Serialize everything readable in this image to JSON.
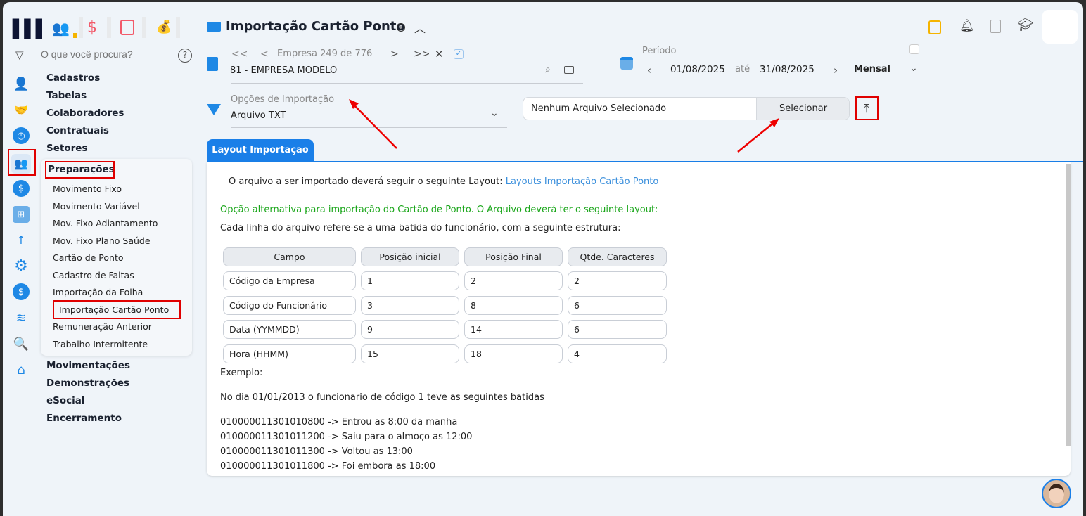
{
  "top_modules": [
    "people-icon",
    "dollar-icon",
    "calculator-icon",
    "money-bag-icon"
  ],
  "search": {
    "placeholder": "O que você procura?"
  },
  "sidebar": {
    "main_top": [
      "Cadastros",
      "Tabelas",
      "Colaboradores",
      "Contratuais",
      "Setores"
    ],
    "active_group": "Preparações",
    "sub_items": [
      "Movimento Fixo",
      "Movimento Variável",
      "Mov. Fixo Adiantamento",
      "Mov. Fixo Plano Saúde",
      "Cartão de Ponto",
      "Cadastro de Faltas",
      "Importação da Folha",
      "Importação Cartão Ponto",
      "Remuneração Anterior",
      "Trabalho Intermitente"
    ],
    "main_bottom": [
      "Movimentações",
      "Demonstrações",
      "eSocial",
      "Encerramento"
    ]
  },
  "header": {
    "title": "Importação Cartão Ponto"
  },
  "empresa": {
    "nav_label": "Empresa",
    "current": "249",
    "sep": "de",
    "total": "776",
    "value": "81 - EMPRESA MODELO"
  },
  "periodo": {
    "label": "Período",
    "from": "01/08/2025",
    "sep": "até",
    "to": "31/08/2025",
    "mode": "Mensal"
  },
  "opcoes": {
    "label": "Opções de Importação",
    "value": "Arquivo TXT"
  },
  "file": {
    "value": "Nenhum Arquivo Selecionado",
    "button": "Selecionar"
  },
  "tab": "Layout Importação",
  "content": {
    "intro": "O arquivo a ser importado deverá seguir o seguinte Layout:",
    "intro_link": "Layouts Importação Cartão Ponto",
    "alt": "Opção alternativa para importação do Cartão de Ponto. O Arquivo deverá ter o seguinte layout:",
    "desc": "Cada linha do arquivo refere-se a uma batida do funcionário, com a seguinte estrutura:",
    "table_headers": [
      "Campo",
      "Posição inicial",
      "Posição Final",
      "Qtde. Caracteres"
    ],
    "rows": [
      [
        "Código da Empresa",
        "1",
        "2",
        "2"
      ],
      [
        "Código do Funcionário",
        "3",
        "8",
        "6"
      ],
      [
        "Data (YYMMDD)",
        "9",
        "14",
        "6"
      ],
      [
        "Hora (HHMM)",
        "15",
        "18",
        "4"
      ]
    ],
    "exemplo": "Exemplo:",
    "exemplo_desc": "No dia 01/01/2013 o funcionario de código 1 teve as seguintes batidas",
    "lines": [
      "010000011301010800 -> Entrou as 8:00 da manha",
      "010000011301011200 -> Saiu para o almoço as 12:00",
      "010000011301011300 -> Voltou as 13:00",
      "010000011301011800 -> Foi embora as 18:00"
    ]
  }
}
